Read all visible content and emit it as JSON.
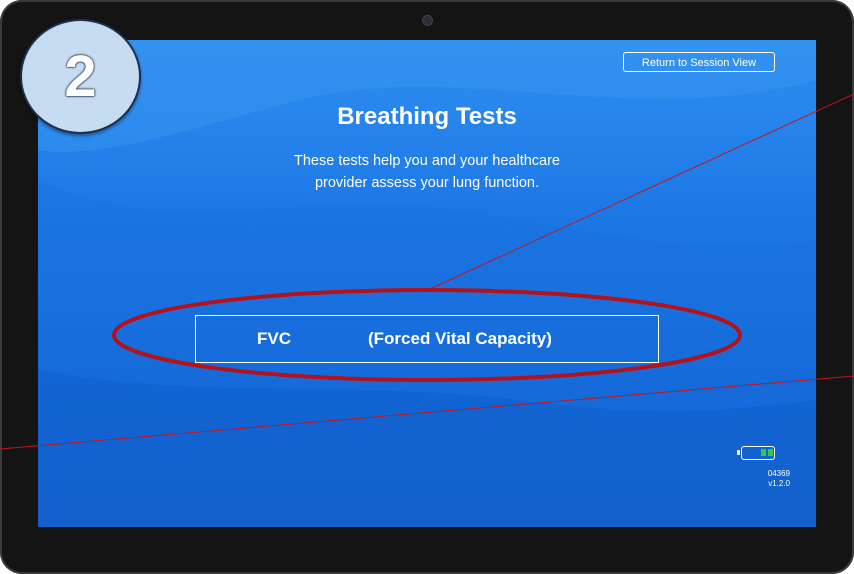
{
  "step_badge": {
    "number": "2",
    "color": "#c5dcf1"
  },
  "screen": {
    "return_button_label": "Return to Session View",
    "title": "Breathing Tests",
    "subtitle_lines": [
      "These tests help you and your healthcare",
      "provider assess your lung function."
    ],
    "test_button": {
      "abbreviation": "FVC",
      "full_name": "(Forced Vital Capacity)"
    },
    "status": {
      "battery_icon": "battery-icon",
      "battery_color": "#2ecc40",
      "device_number": "04369",
      "version": "v1.2.0"
    }
  },
  "colors": {
    "screen_top": "#2f8ff0",
    "screen_bottom": "#0f58c4",
    "highlight_ellipse": "#b3121b",
    "leader_lines": "#c0161f",
    "bezel": "#141414"
  }
}
